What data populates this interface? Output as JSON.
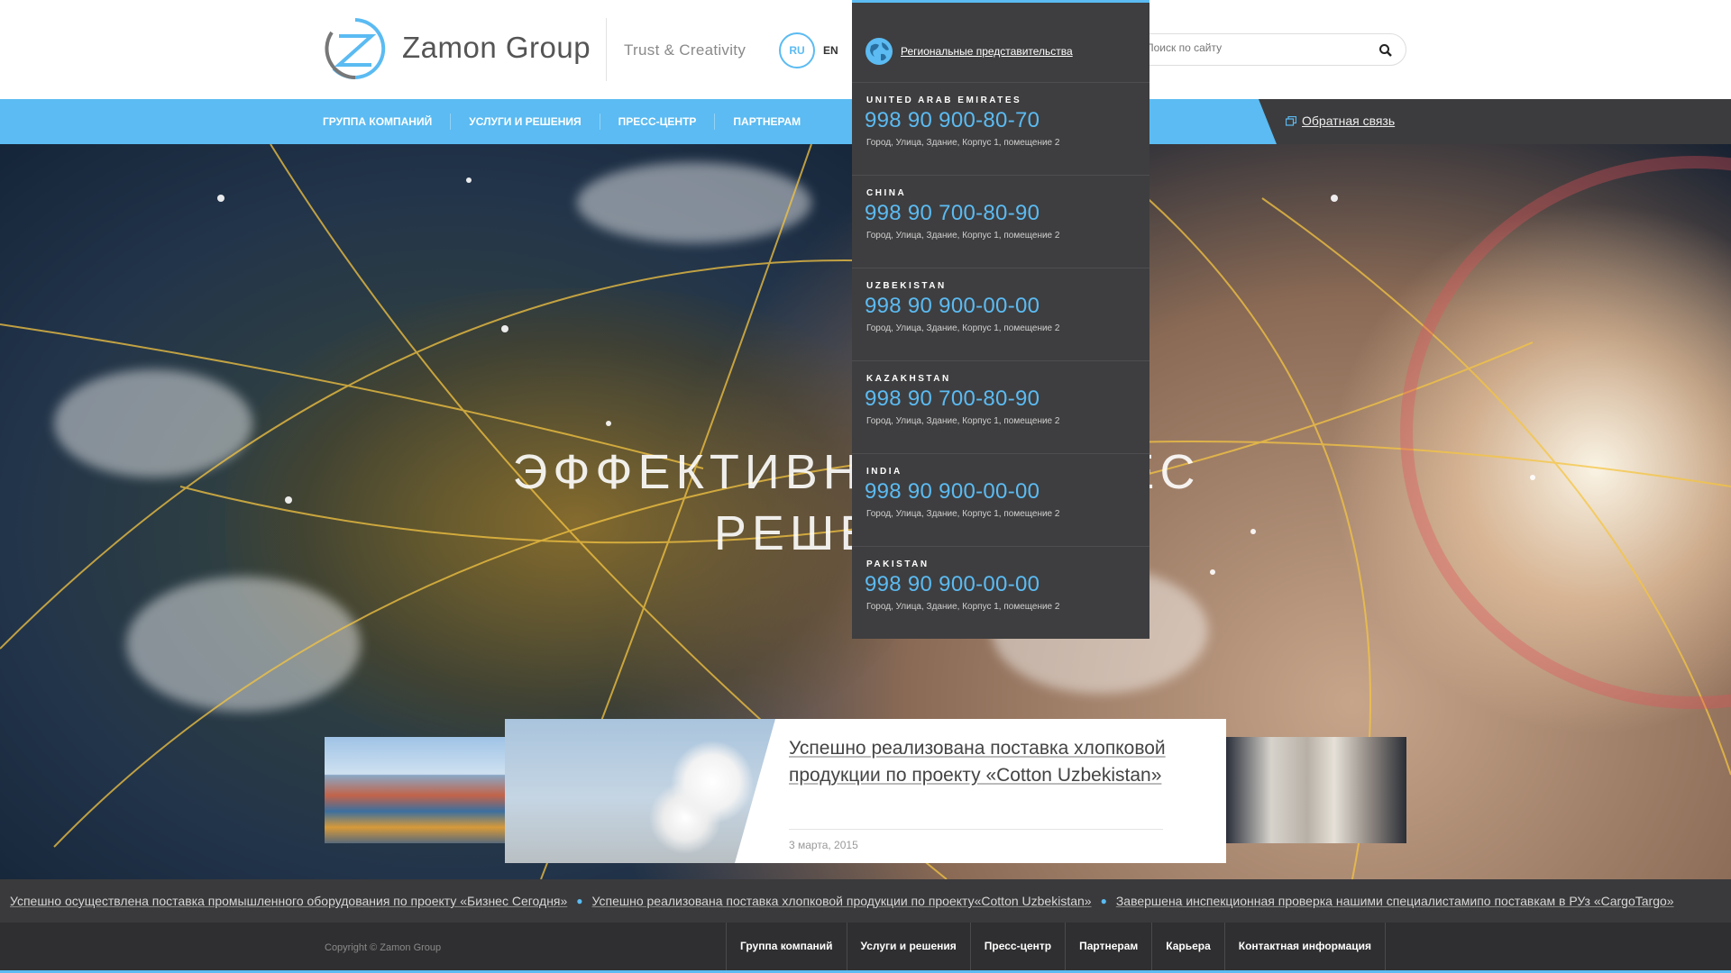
{
  "header": {
    "logo_text": "Zamon Group",
    "tagline": "Trust & Creativity",
    "lang_ru": "RU",
    "lang_en": "EN",
    "search_placeholder": "Поиск по сайту"
  },
  "nav": {
    "items": [
      "ГРУППА КОМПАНИЙ",
      "УСЛУГИ И РЕШЕНИЯ",
      "ПРЕСС-ЦЕНТР",
      "ПАРТНЕРАМ"
    ],
    "feedback": "Обратная связь"
  },
  "hero": {
    "title_line1": "ЭФФЕКТИВНЫЕ БИЗНЕС",
    "title_line2": "РЕШЕНИЯ"
  },
  "dropdown": {
    "header_link": "Региональные представительства",
    "regions": [
      {
        "country": "UNITED ARAB EMIRATES",
        "phone": "998 90 900-80-70",
        "address": "Город, Улица, Здание, Корпус 1, помещение 2"
      },
      {
        "country": "CHINA",
        "phone": "998 90 700-80-90",
        "address": "Город, Улица, Здание, Корпус 1, помещение 2"
      },
      {
        "country": "UZBEKISTAN",
        "phone": "998 90 900-00-00",
        "address": "Город, Улица, Здание, Корпус 1, помещение 2"
      },
      {
        "country": "KAZAKHSTAN",
        "phone": "998 90 700-80-90",
        "address": "Город, Улица, Здание, Корпус 1, помещение 2"
      },
      {
        "country": "INDIA",
        "phone": "998 90 900-00-00",
        "address": "Город, Улица, Здание, Корпус 1, помещение 2"
      },
      {
        "country": "PAKISTAN",
        "phone": "998 90 900-00-00",
        "address": "Город, Улица, Здание, Корпус 1, помещение 2"
      }
    ]
  },
  "news": {
    "title": "Успешно реализована поставка хлопковой продукции по проекту «Cotton Uzbekistan»",
    "date": "3 марта, 2015"
  },
  "ticker": {
    "items": [
      "Успешно осуществлена поставка промышленного оборудования по проекту «Бизнес Сегодня»",
      "Успешно реализована поставка хлопковой продукции по проекту«Cotton Uzbekistan»",
      "Завершена инспекционная проверка нашими специалистамипо поставкам в РУз «CargoTargo»"
    ]
  },
  "footer": {
    "copyright": "Copyright © Zamon Group",
    "items": [
      "Группа компаний",
      "Услуги и решения",
      "Пресс-центр",
      "Партнерам",
      "Карьера",
      "Контактная информация"
    ]
  },
  "colors": {
    "accent": "#5bbbf2",
    "dark": "#3e3e40",
    "footer": "#2f2f31"
  },
  "icons": [
    "zamon-logo-icon",
    "search-icon",
    "globe-icon",
    "feedback-window-icon"
  ]
}
